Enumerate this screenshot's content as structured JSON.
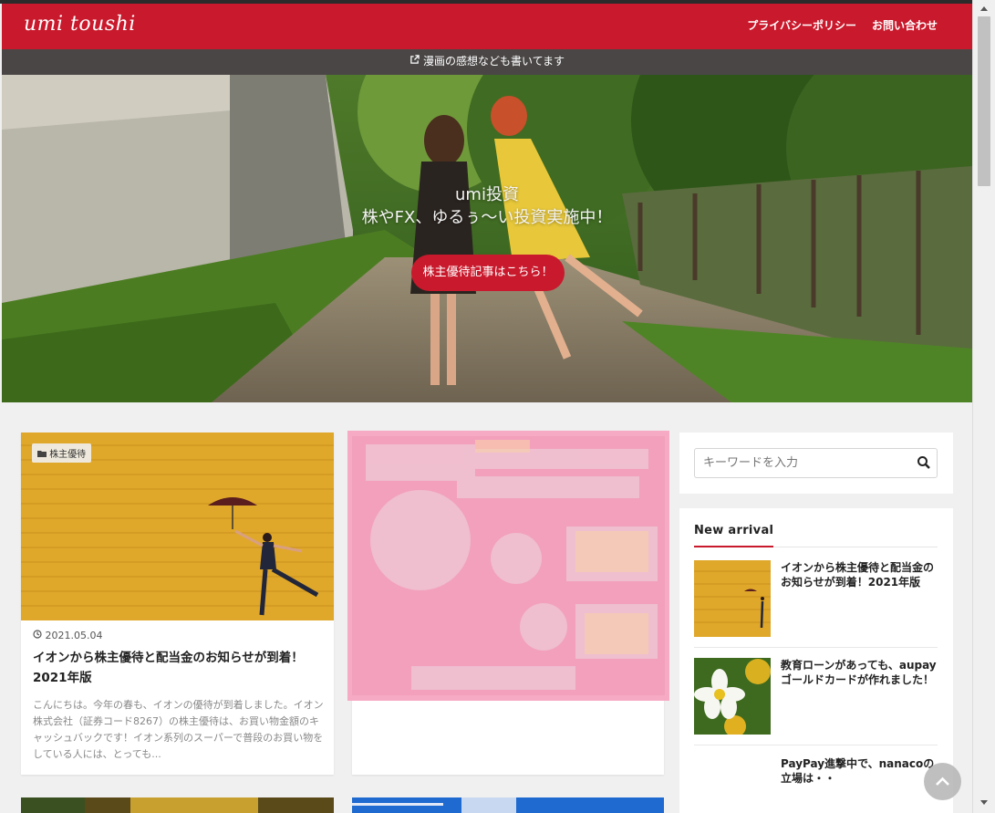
{
  "header": {
    "logo": "umi toushi",
    "nav": [
      {
        "label": "プライバシーポリシー"
      },
      {
        "label": "お問い合わせ"
      }
    ]
  },
  "infobar": {
    "text": "漫画の感想なども書いてます"
  },
  "hero": {
    "title": "umi投資",
    "subtitle": "株やFX、ゆるぅ〜い投資実施中！",
    "button": "株主優待記事はこちら！"
  },
  "posts": [
    {
      "category": "株主優待",
      "date": "2021.05.04",
      "title": "イオンから株主優待と配当金のお知らせが到着！2021年版",
      "excerpt": "こんにちは。今年の春も、イオンの優待が到着しました。イオン株式会社（証券コード8267）の株主優待は、お買い物金額のキャッシュバックです！イオン系列のスーパーで普段のお買い物をしている人には、とっても..."
    }
  ],
  "search": {
    "placeholder": "キーワードを入力"
  },
  "new_arrival": {
    "title": "New arrival",
    "items": [
      {
        "title": "イオンから株主優待と配当金のお知らせが到着！2021年版"
      },
      {
        "title": "教育ローンがあっても、aupayゴールドカードが作れました！"
      },
      {
        "title": "PayPay進撃中で、nanacoの立場は・・"
      }
    ]
  },
  "colors": {
    "brand_red": "#c9192c",
    "infobar_bg": "#4a4646"
  }
}
